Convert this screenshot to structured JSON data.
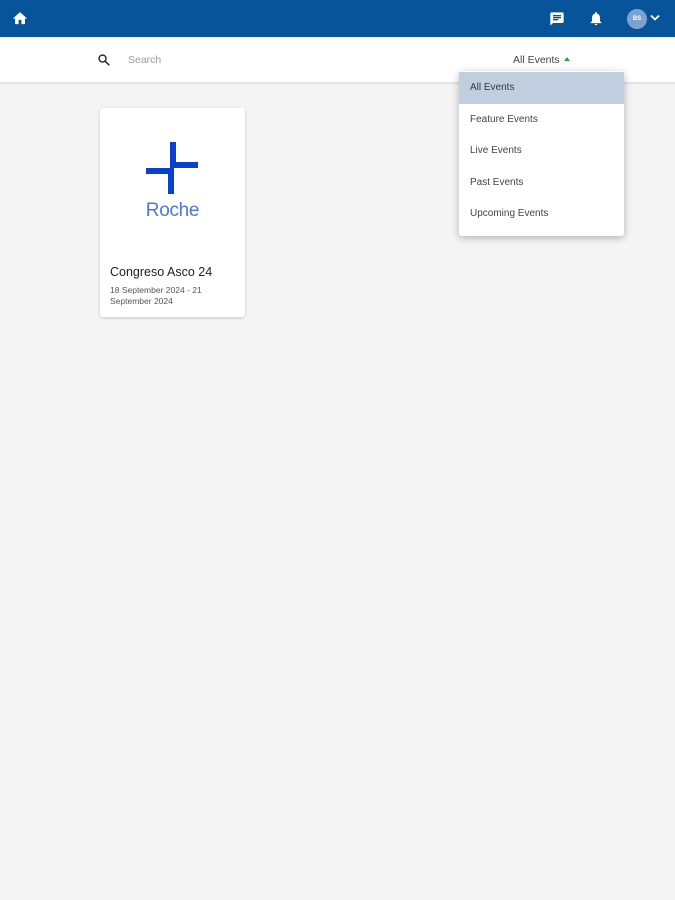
{
  "topbar": {
    "avatar_initials": "BS",
    "icons": [
      "home-icon",
      "chat-icon",
      "bell-icon",
      "chevron-down-icon"
    ],
    "background": "#07549b"
  },
  "search": {
    "placeholder": "Search",
    "value": ""
  },
  "filter": {
    "selected": "All Events",
    "options": [
      {
        "label": "All Events",
        "selected": true
      },
      {
        "label": "Feature Events",
        "selected": false
      },
      {
        "label": "Live Events",
        "selected": false
      },
      {
        "label": "Past Events",
        "selected": false
      },
      {
        "label": "Upcoming Events",
        "selected": false
      }
    ]
  },
  "events": [
    {
      "logo_text": "Roche",
      "title": "Congreso Asco 24",
      "dates": "18 September 2024 - 21 September 2024"
    }
  ],
  "colors": {
    "accent": "#07549b",
    "logo_blue": "#0b3fd1",
    "logo_text": "#4a78d6",
    "selected_option": "#bfcfe0",
    "caret_green": "#2e9e4c"
  }
}
